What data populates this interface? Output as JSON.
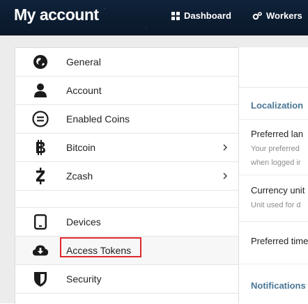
{
  "header": {
    "title": "My account",
    "nav": [
      {
        "label": "Dashboard",
        "icon": "grid-icon"
      },
      {
        "label": "Workers",
        "icon": "gears-icon"
      }
    ]
  },
  "sidebar": {
    "items": [
      {
        "label": "General",
        "icon": "globe-icon",
        "chevron": false
      },
      {
        "label": "Account",
        "icon": "user-icon",
        "chevron": false
      },
      {
        "label": "Enabled Coins",
        "icon": "equals-circle-icon",
        "chevron": false
      },
      {
        "label": "Bitcoin",
        "icon": "bitcoin-icon",
        "chevron": true
      },
      {
        "label": "Zcash",
        "icon": "zcash-icon",
        "chevron": true
      },
      {
        "label": "Devices",
        "icon": "tablet-icon",
        "chevron": false
      },
      {
        "label": "Access Tokens",
        "icon": "cloud-download-icon",
        "chevron": false,
        "highlighted": true
      },
      {
        "label": "Security",
        "icon": "shield-icon",
        "chevron": false
      }
    ],
    "chevron_glyph": "›"
  },
  "panel": {
    "localization_heading": "Localization",
    "preferred_language_label": "Preferred lan",
    "preferred_language_hint_1": "Your preferred",
    "preferred_language_hint_2": "when logged ir",
    "currency_unit_label": "Currency unit",
    "currency_unit_hint": "Unit used for d",
    "preferred_time_label": "Preferred time",
    "notifications_heading": "Notifications"
  },
  "colors": {
    "header_bg": "#0c1b2f",
    "section_heading": "#4a7796",
    "highlight_border": "#e0282e"
  }
}
